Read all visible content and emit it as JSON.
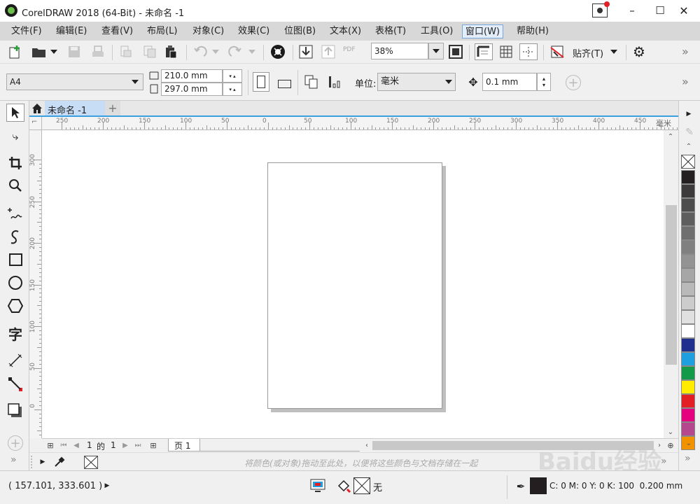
{
  "window": {
    "title": "CorelDRAW 2018 (64-Bit) - 未命名 -1",
    "minimize": "–",
    "maximize": "☐",
    "close": "✕"
  },
  "menu": [
    "文件(F)",
    "编辑(E)",
    "查看(V)",
    "布局(L)",
    "对象(C)",
    "效果(C)",
    "位图(B)",
    "文本(X)",
    "表格(T)",
    "工具(O)",
    "窗口(W)",
    "帮助(H)"
  ],
  "menu_active_index": 10,
  "toolbar": {
    "zoom_value": "38%",
    "snap_label": "贴齐(T)",
    "pdf_label": "PDF",
    "more": "»"
  },
  "propbar": {
    "paper_size": "A4",
    "width": "210.0 mm",
    "height": "297.0 mm",
    "units_label": "单位:",
    "units_value": "毫米",
    "nudge_value": "0.1 mm",
    "more": "»"
  },
  "doc_tab": {
    "title": "未命名 -1",
    "add": "+"
  },
  "ruler": {
    "unit": "毫米",
    "h_ticks": [
      "250",
      "200",
      "150",
      "100",
      "50",
      "0",
      "50",
      "100",
      "150",
      "200",
      "250",
      "300",
      "350",
      "400",
      "450"
    ],
    "v_ticks": [
      "300",
      "250",
      "200",
      "150",
      "100",
      "50",
      "0"
    ]
  },
  "pagebar": {
    "current": "1",
    "of_label": "的",
    "total": "1",
    "page_tab": "页 1"
  },
  "doc_palette_hint": "将颜色(或对象)拖动至此处，以便将这些颜色与文档存储在一起",
  "status": {
    "coords": "( 157.101, 333.601 )",
    "fill_label": "无",
    "outline_info": "C: 0 M: 0 Y: 0 K: 100  0.200 mm"
  },
  "palette_colors": [
    "#231f20",
    "#3c3a3a",
    "#4d4d4d",
    "#5e5e5e",
    "#6f6f6f",
    "#808080",
    "#939393",
    "#a6a6a6",
    "#b9b9b9",
    "#cccccc",
    "#e0e0e0",
    "#ffffff",
    "#1f2f8f",
    "#1e9fe0",
    "#129a49",
    "#ffec00",
    "#e31e24",
    "#e4007f",
    "#b5478f",
    "#f39200"
  ],
  "watermark": "Baidu经验"
}
